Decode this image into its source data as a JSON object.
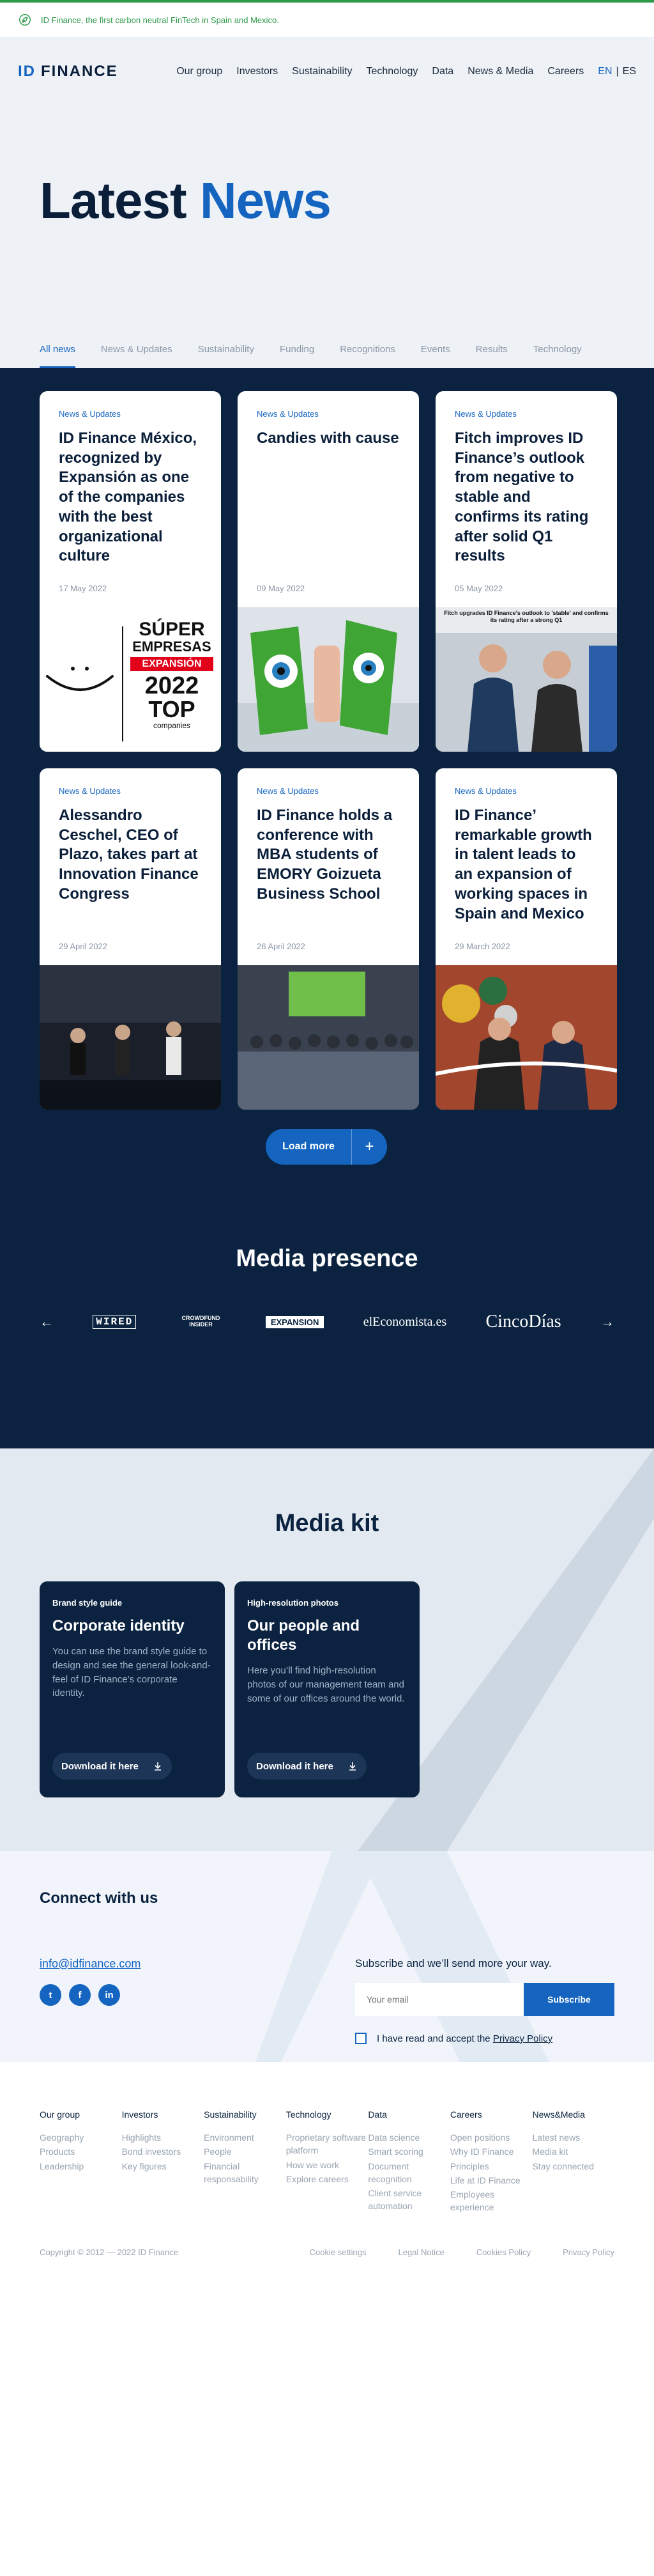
{
  "banner": {
    "message": "ID Finance, the first carbon neutral FinTech in Spain and Mexico.",
    "icon": "leaf-icon"
  },
  "header": {
    "logo": {
      "id": "ID",
      "finance": "FINANCE"
    },
    "menu": [
      "Our group",
      "Investors",
      "Sustainability",
      "Technology",
      "Data",
      "News & Media",
      "Careers"
    ],
    "lang": {
      "en": "EN",
      "sep": "|",
      "es": "ES"
    }
  },
  "hero": {
    "title_dark": "Latest",
    "title_blue": "News"
  },
  "tabs": [
    "All news",
    "News & Updates",
    "Sustainability",
    "Funding",
    "Recognitions",
    "Events",
    "Results",
    "Technology"
  ],
  "articles": [
    {
      "category": "News & Updates",
      "title": "ID Finance México, recognized by Expansión as one of the companies with the best organizational culture",
      "date": "17 May 2022"
    },
    {
      "category": "News & Updates",
      "title": "Candies with cause",
      "date": "09 May 2022"
    },
    {
      "category": "News & Updates",
      "title": "Fitch improves ID Finance’s outlook from negative to stable and confirms its rating after solid Q1 results",
      "date": "05 May 2022"
    },
    {
      "category": "News & Updates",
      "title": "Alessandro Ceschel, CEO of Plazo, takes part at Innovation Finance Congress",
      "date": "29 April 2022"
    },
    {
      "category": "News & Updates",
      "title": "ID Finance holds a conference with MBA students of EMORY Goizueta Business School",
      "date": "26 April 2022"
    },
    {
      "category": "News & Updates",
      "title": "ID Finance’ remarkable growth in talent leads to an expansion of working spaces in Spain and Mexico",
      "date": "29 March 2022"
    }
  ],
  "images": {
    "super_empresas": {
      "line1": "SÚPER",
      "line2": "EMPRESAS",
      "line3": "EXPANSIÓN",
      "year": "2022",
      "top": "TOP",
      "companies": "companies"
    },
    "fitch_headline": "Fitch upgrades ID Finance's outlook to 'stable' and confirms its rating after a strong Q1"
  },
  "load_more": {
    "label": "Load more",
    "icon": "+"
  },
  "media_presence": {
    "title": "Media presence",
    "logos": [
      "WIRED",
      "CROWDFUND INSIDER",
      "EXPANSION",
      "elEconomista.es",
      "CincoDías"
    ]
  },
  "media_kit": {
    "title": "Media kit",
    "cards": [
      {
        "category": "Brand style guide",
        "title": "Corporate identity",
        "description": "You can use the brand style guide to design and see the general look-and-feel of ID Finance’s corporate identity.",
        "button": "Download it here"
      },
      {
        "category": "High-resolution photos",
        "title": "Our people and offices",
        "description": "Here you’ll find high-resolution photos of our management team and some of our offices around the world.",
        "button": "Download it here"
      }
    ]
  },
  "connect": {
    "title": "Connect with us",
    "email": "info@idfinance.com",
    "social": [
      "t",
      "f",
      "in"
    ],
    "subscribe_note": "Subscribe and we’ll send more your way.",
    "email_placeholder": "Your email",
    "subscribe_button": "Subscribe",
    "consent_text": "I have read and accept the",
    "consent_link": "Privacy Policy"
  },
  "footer": {
    "columns": [
      {
        "heading": "Our group",
        "links": [
          "Geography",
          "Products",
          "Leadership"
        ]
      },
      {
        "heading": "Investors",
        "links": [
          "Highlights",
          "Bond investors",
          "Key figures"
        ]
      },
      {
        "heading": "Sustainability",
        "links": [
          "Environment",
          "People",
          "Financial responsability"
        ]
      },
      {
        "heading": "Technology",
        "links": [
          "Proprietary software platform",
          "How we work",
          "Explore careers"
        ]
      },
      {
        "heading": "Data",
        "links": [
          "Data science",
          "Smart scoring",
          "Document recognition",
          "Client service automation"
        ]
      },
      {
        "heading": "Careers",
        "links": [
          "Open positions",
          "Why ID Finance",
          "Principles",
          "Life at ID Finance",
          "Employees experience"
        ]
      },
      {
        "heading": "News&Media",
        "links": [
          "Latest news",
          "Media kit",
          "Stay connected"
        ]
      }
    ],
    "copyright": "Copyright © 2012 — 2022 ID Finance",
    "legal": [
      "Cookie settings",
      "Legal Notice",
      "Cookies Policy",
      "Privacy Policy"
    ]
  },
  "colors": {
    "brand_blue": "#1565c0",
    "navy": "#0b2340",
    "green": "#2d9a4a"
  }
}
